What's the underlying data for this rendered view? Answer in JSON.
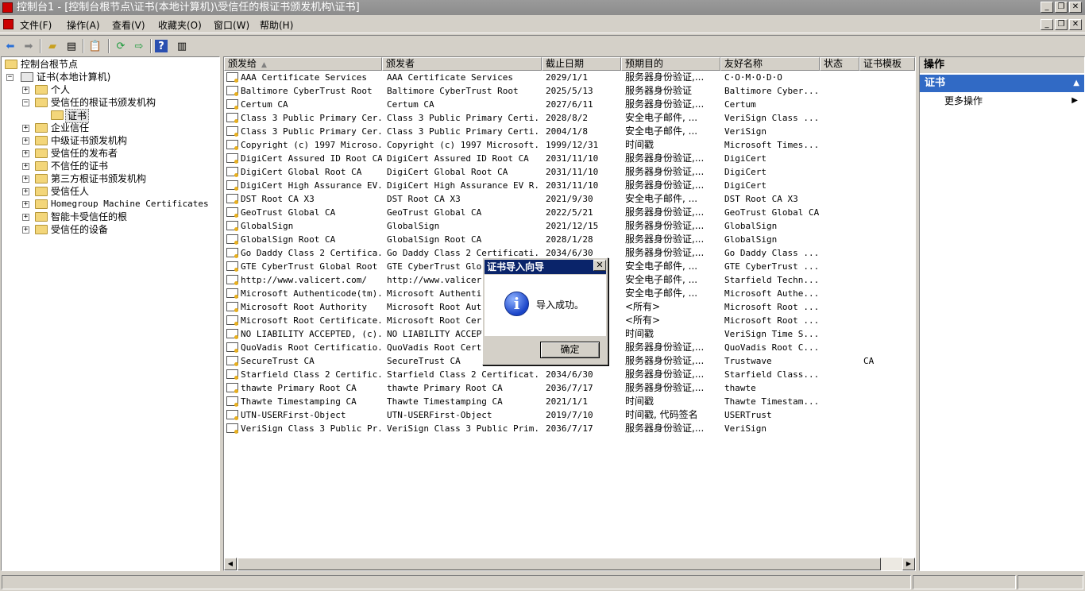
{
  "window": {
    "title": "控制台1 - [控制台根节点\\证书(本地计算机)\\受信任的根证书颁发机构\\证书]"
  },
  "menubar": {
    "items": [
      "文件(F)",
      "操作(A)",
      "查看(V)",
      "收藏夹(O)",
      "窗口(W)",
      "帮助(H)"
    ]
  },
  "toolbar": {
    "buttons": [
      "back-icon",
      "forward-icon",
      "up-folder-icon",
      "show-tree-icon",
      "copy-icon",
      "refresh-icon",
      "export-icon",
      "help-icon",
      "show-action-pane-icon"
    ]
  },
  "tree": {
    "root": "控制台根节点",
    "computer": "证书(本地计算机)",
    "children": [
      "个人",
      "受信任的根证书颁发机构",
      "证书",
      "企业信任",
      "中级证书颁发机构",
      "受信任的发布者",
      "不信任的证书",
      "第三方根证书颁发机构",
      "受信任人",
      "Homegroup Machine Certificates",
      "智能卡受信任的根",
      "受信任的设备"
    ]
  },
  "list": {
    "columns": [
      "颁发给",
      "颁发者",
      "截止日期",
      "预期目的",
      "友好名称",
      "状态",
      "证书模板"
    ],
    "rows": [
      [
        "AAA Certificate Services",
        "AAA Certificate Services",
        "2029/1/1",
        "服务器身份验证,...",
        "C·O·M·O·D·O",
        "",
        ""
      ],
      [
        "Baltimore CyberTrust Root",
        "Baltimore CyberTrust Root",
        "2025/5/13",
        "服务器身份验证",
        "Baltimore Cyber...",
        "",
        ""
      ],
      [
        "Certum CA",
        "Certum CA",
        "2027/6/11",
        "服务器身份验证,...",
        "Certum",
        "",
        ""
      ],
      [
        "Class 3 Public Primary Cer...",
        "Class 3 Public Primary Certi...",
        "2028/8/2",
        "安全电子邮件, ...",
        "VeriSign Class ...",
        "",
        ""
      ],
      [
        "Class 3 Public Primary Cer...",
        "Class 3 Public Primary Certi...",
        "2004/1/8",
        "安全电子邮件, ...",
        "VeriSign",
        "",
        ""
      ],
      [
        "Copyright (c) 1997 Microso...",
        "Copyright (c) 1997 Microsoft...",
        "1999/12/31",
        "时间戳",
        "Microsoft Times...",
        "",
        ""
      ],
      [
        "DigiCert Assured ID Root CA",
        "DigiCert Assured ID Root CA",
        "2031/11/10",
        "服务器身份验证,...",
        "DigiCert",
        "",
        ""
      ],
      [
        "DigiCert Global Root CA",
        "DigiCert Global Root CA",
        "2031/11/10",
        "服务器身份验证,...",
        "DigiCert",
        "",
        ""
      ],
      [
        "DigiCert High Assurance EV...",
        "DigiCert High Assurance EV R...",
        "2031/11/10",
        "服务器身份验证,...",
        "DigiCert",
        "",
        ""
      ],
      [
        "DST Root CA X3",
        "DST Root CA X3",
        "2021/9/30",
        "安全电子邮件, ...",
        "DST Root CA X3",
        "",
        ""
      ],
      [
        "GeoTrust Global CA",
        "GeoTrust Global CA",
        "2022/5/21",
        "服务器身份验证,...",
        "GeoTrust Global CA",
        "",
        ""
      ],
      [
        "GlobalSign",
        "GlobalSign",
        "2021/12/15",
        "服务器身份验证,...",
        "GlobalSign",
        "",
        ""
      ],
      [
        "GlobalSign Root CA",
        "GlobalSign Root CA",
        "2028/1/28",
        "服务器身份验证,...",
        "GlobalSign",
        "",
        ""
      ],
      [
        "Go Daddy Class 2 Certifica...",
        "Go Daddy Class 2 Certificati...",
        "2034/6/30",
        "服务器身份验证,...",
        "Go Daddy Class ...",
        "",
        ""
      ],
      [
        "GTE CyberTrust Global Root",
        "GTE CyberTrust Globa",
        "",
        "安全电子邮件, ...",
        "GTE CyberTrust ...",
        "",
        ""
      ],
      [
        "http://www.valicert.com/",
        "http://www.valicert.",
        "",
        "安全电子邮件, ...",
        "Starfield Techn...",
        "",
        ""
      ],
      [
        "Microsoft Authenticode(tm)...",
        "Microsoft Authentico",
        "",
        "安全电子邮件, ...",
        "Microsoft Authe...",
        "",
        ""
      ],
      [
        "Microsoft Root Authority",
        "Microsoft Root Autho",
        "",
        "<所有>",
        "Microsoft Root ...",
        "",
        ""
      ],
      [
        "Microsoft Root Certificate...",
        "Microsoft Root Certi",
        "",
        "<所有>",
        "Microsoft Root ...",
        "",
        ""
      ],
      [
        "NO LIABILITY ACCEPTED, (c)...",
        "NO LIABILITY ACCEPTE",
        "",
        "时间戳",
        "VeriSign Time S...",
        "",
        ""
      ],
      [
        "QuoVadis Root Certificatio...",
        "QuoVadis Root Certif",
        "",
        "服务器身份验证,...",
        "QuoVadis Root C...",
        "",
        ""
      ],
      [
        "SecureTrust CA",
        "SecureTrust CA",
        "",
        "服务器身份验证,...",
        "Trustwave",
        "",
        "CA"
      ],
      [
        "Starfield Class 2 Certific...",
        "Starfield Class 2 Certificat...",
        "2034/6/30",
        "服务器身份验证,...",
        "Starfield Class...",
        "",
        ""
      ],
      [
        "thawte Primary Root CA",
        "thawte Primary Root CA",
        "2036/7/17",
        "服务器身份验证,...",
        "thawte",
        "",
        ""
      ],
      [
        "Thawte Timestamping CA",
        "Thawte Timestamping CA",
        "2021/1/1",
        "时间戳",
        "Thawte Timestam...",
        "",
        ""
      ],
      [
        "UTN-USERFirst-Object",
        "UTN-USERFirst-Object",
        "2019/7/10",
        "时间戳, 代码签名",
        "USERTrust",
        "",
        ""
      ],
      [
        "VeriSign Class 3 Public Pr...",
        "VeriSign Class 3 Public Prim...",
        "2036/7/17",
        "服务器身份验证,...",
        "VeriSign",
        "",
        ""
      ]
    ]
  },
  "actions": {
    "header": "操作",
    "section": "证书",
    "more": "更多操作"
  },
  "dialog": {
    "title": "证书导入向导",
    "message": "导入成功。",
    "ok_label": "确定"
  }
}
